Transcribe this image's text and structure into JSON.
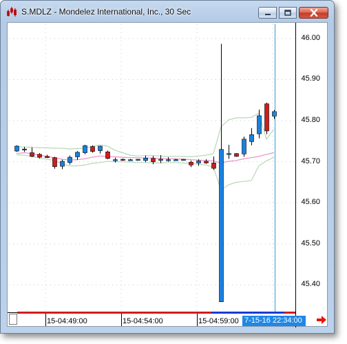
{
  "window": {
    "title": "S.MDLZ - Mondelez International, Inc., 30 Sec"
  },
  "icons": {
    "app": "stock-chart-icon",
    "minimize": "minimize-icon",
    "maximize": "maximize-icon",
    "close": "close-icon",
    "scroll_right": "red-right-arrow-icon"
  },
  "colors": {
    "up_candle": "#1a80e0",
    "down_candle": "#d01c1c",
    "bollinger": "#b7d7b7",
    "moving_average": "#e890c8",
    "cursor": "#2e9fd0",
    "time_cursor_bg": "#1f87e6"
  },
  "chart_data": {
    "type": "candlestick",
    "title": "",
    "ylim": [
      45.33,
      46.02
    ],
    "y_ticks": [
      "46.00",
      "45.90",
      "45.80",
      "45.70",
      "45.60",
      "45.50",
      "45.40"
    ],
    "x_ticks": [
      "15-04:49:00",
      "15-04:54:00",
      "15-04:59:00"
    ],
    "time_cursor_label": "7-15-16 22:34:00",
    "candles": [
      {
        "o": 45.726,
        "h": 45.74,
        "l": 45.724,
        "c": 45.738
      },
      {
        "o": 45.729,
        "h": 45.736,
        "l": 45.724,
        "c": 45.731
      },
      {
        "o": 45.722,
        "h": 45.735,
        "l": 45.711,
        "c": 45.713
      },
      {
        "o": 45.718,
        "h": 45.721,
        "l": 45.708,
        "c": 45.711
      },
      {
        "o": 45.713,
        "h": 45.717,
        "l": 45.709,
        "c": 45.71
      },
      {
        "o": 45.71,
        "h": 45.712,
        "l": 45.683,
        "c": 45.688
      },
      {
        "o": 45.689,
        "h": 45.705,
        "l": 45.682,
        "c": 45.701
      },
      {
        "o": 45.698,
        "h": 45.715,
        "l": 45.693,
        "c": 45.711
      },
      {
        "o": 45.712,
        "h": 45.726,
        "l": 45.704,
        "c": 45.723
      },
      {
        "o": 45.722,
        "h": 45.741,
        "l": 45.718,
        "c": 45.739
      },
      {
        "o": 45.737,
        "h": 45.74,
        "l": 45.722,
        "c": 45.725
      },
      {
        "o": 45.727,
        "h": 45.739,
        "l": 45.72,
        "c": 45.738
      },
      {
        "o": 45.724,
        "h": 45.727,
        "l": 45.706,
        "c": 45.708
      },
      {
        "o": 45.704,
        "h": 45.71,
        "l": 45.698,
        "c": 45.705
      },
      {
        "o": 45.706,
        "h": 45.708,
        "l": 45.702,
        "c": 45.705
      },
      {
        "o": 45.705,
        "h": 45.707,
        "l": 45.703,
        "c": 45.705
      },
      {
        "o": 45.705,
        "h": 45.707,
        "l": 45.703,
        "c": 45.706
      },
      {
        "o": 45.703,
        "h": 45.715,
        "l": 45.699,
        "c": 45.709
      },
      {
        "o": 45.708,
        "h": 45.714,
        "l": 45.694,
        "c": 45.7
      },
      {
        "o": 45.704,
        "h": 45.716,
        "l": 45.697,
        "c": 45.706
      },
      {
        "o": 45.704,
        "h": 45.711,
        "l": 45.7,
        "c": 45.705
      },
      {
        "o": 45.705,
        "h": 45.707,
        "l": 45.703,
        "c": 45.705
      },
      {
        "o": 45.705,
        "h": 45.707,
        "l": 45.703,
        "c": 45.706
      },
      {
        "o": 45.699,
        "h": 45.703,
        "l": 45.687,
        "c": 45.692
      },
      {
        "o": 45.697,
        "h": 45.706,
        "l": 45.69,
        "c": 45.702
      },
      {
        "o": 45.701,
        "h": 45.706,
        "l": 45.695,
        "c": 45.697
      },
      {
        "o": 45.697,
        "h": 45.713,
        "l": 45.68,
        "c": 45.684
      },
      {
        "o": 45.359,
        "h": 45.987,
        "l": 45.359,
        "c": 45.73
      },
      {
        "o": 45.72,
        "h": 45.741,
        "l": 45.707,
        "c": 45.72
      },
      {
        "o": 45.72,
        "h": 45.721,
        "l": 45.712,
        "c": 45.713
      },
      {
        "o": 45.719,
        "h": 45.761,
        "l": 45.712,
        "c": 45.755
      },
      {
        "o": 45.749,
        "h": 45.782,
        "l": 45.74,
        "c": 45.766
      },
      {
        "o": 45.768,
        "h": 45.827,
        "l": 45.757,
        "c": 45.812
      },
      {
        "o": 45.841,
        "h": 45.844,
        "l": 45.767,
        "c": 45.775
      },
      {
        "o": 45.811,
        "h": 45.826,
        "l": 45.804,
        "c": 45.822
      }
    ],
    "bollinger_upper": [
      45.737,
      45.736,
      45.735,
      45.734,
      45.734,
      45.733,
      45.733,
      45.731,
      45.732,
      45.733,
      45.737,
      45.741,
      45.738,
      45.728,
      45.722,
      45.716,
      45.714,
      45.715,
      45.715,
      45.714,
      45.713,
      45.713,
      45.713,
      45.712,
      45.714,
      45.716,
      45.72,
      45.785,
      45.802,
      45.807,
      45.807,
      45.808,
      45.818,
      45.755,
      45.78
    ],
    "bollinger_lower": [
      45.717,
      45.716,
      45.713,
      45.709,
      45.706,
      45.703,
      45.695,
      45.69,
      45.69,
      45.692,
      45.696,
      45.698,
      45.701,
      45.7,
      45.7,
      45.699,
      45.698,
      45.698,
      45.697,
      45.697,
      45.698,
      45.698,
      45.697,
      45.696,
      45.694,
      45.692,
      45.687,
      45.631,
      45.644,
      45.65,
      45.652,
      45.654,
      45.69,
      45.702,
      45.711
    ],
    "moving_average": [
      45.72,
      45.722,
      45.72,
      45.716,
      45.713,
      45.71,
      45.706,
      45.704,
      45.705,
      45.707,
      45.711,
      45.714,
      45.713,
      45.712,
      45.711,
      45.71,
      45.71,
      45.709,
      45.709,
      45.708,
      45.707,
      45.707,
      45.706,
      45.705,
      45.704,
      45.703,
      45.702,
      45.697,
      45.701,
      45.703,
      45.707,
      45.71,
      45.713,
      45.718,
      45.722
    ]
  }
}
